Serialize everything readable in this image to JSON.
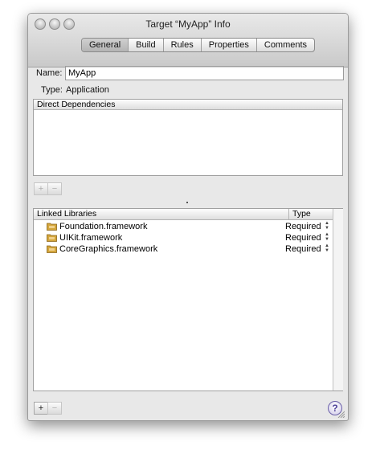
{
  "window": {
    "title": "Target “MyApp” Info"
  },
  "tabs": [
    {
      "label": "General",
      "active": true
    },
    {
      "label": "Build",
      "active": false
    },
    {
      "label": "Rules",
      "active": false
    },
    {
      "label": "Properties",
      "active": false
    },
    {
      "label": "Comments",
      "active": false
    }
  ],
  "general": {
    "name_label": "Name:",
    "name_value": "MyApp",
    "type_label": "Type:",
    "type_value": "Application"
  },
  "dependencies": {
    "header": "Direct Dependencies",
    "add_label": "+",
    "remove_label": "−"
  },
  "libraries": {
    "col_name": "Linked Libraries",
    "col_type": "Type",
    "rows": [
      {
        "name": "Foundation.framework",
        "type": "Required"
      },
      {
        "name": "UIKit.framework",
        "type": "Required"
      },
      {
        "name": "CoreGraphics.framework",
        "type": "Required"
      }
    ],
    "add_label": "+",
    "remove_label": "−"
  },
  "help": {
    "label": "?"
  },
  "colors": {
    "window_bg": "#e8e8e8",
    "help_accent": "#4b3e97",
    "folder_icon": "#c99a2e"
  }
}
